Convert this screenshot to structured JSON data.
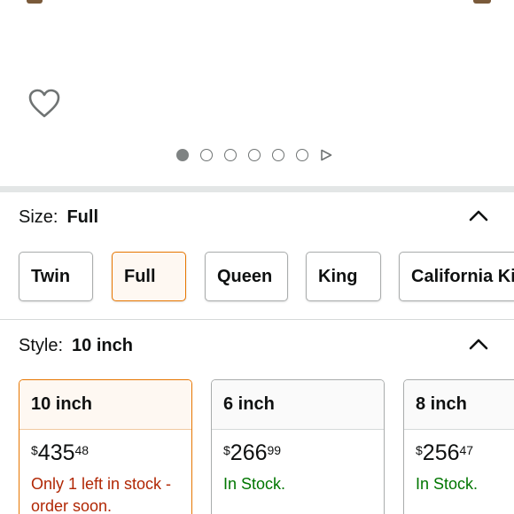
{
  "gallery": {
    "slides": 6,
    "active_index": 0
  },
  "size": {
    "label": "Size:",
    "selected": "Full",
    "options": [
      "Twin",
      "Full",
      "Queen",
      "King",
      "California King"
    ]
  },
  "style": {
    "label": "Style:",
    "selected": "10 inch",
    "options": [
      {
        "name": "10 inch",
        "currency": "$",
        "whole": "435",
        "fraction": "48",
        "stock": "Only 1 left in stock - order soon."
      },
      {
        "name": "6 inch",
        "currency": "$",
        "whole": "266",
        "fraction": "99",
        "stock": "In Stock."
      },
      {
        "name": "8 inch",
        "currency": "$",
        "whole": "256",
        "fraction": "47",
        "stock": "In Stock."
      }
    ]
  },
  "colors": {
    "accent_selected": "#e77600",
    "low_stock": "#b12704",
    "in_stock": "#007600"
  },
  "icons": {
    "wishlist": "heart-icon",
    "collapse": "chevron-up-icon",
    "gallery_next": "play-icon"
  }
}
